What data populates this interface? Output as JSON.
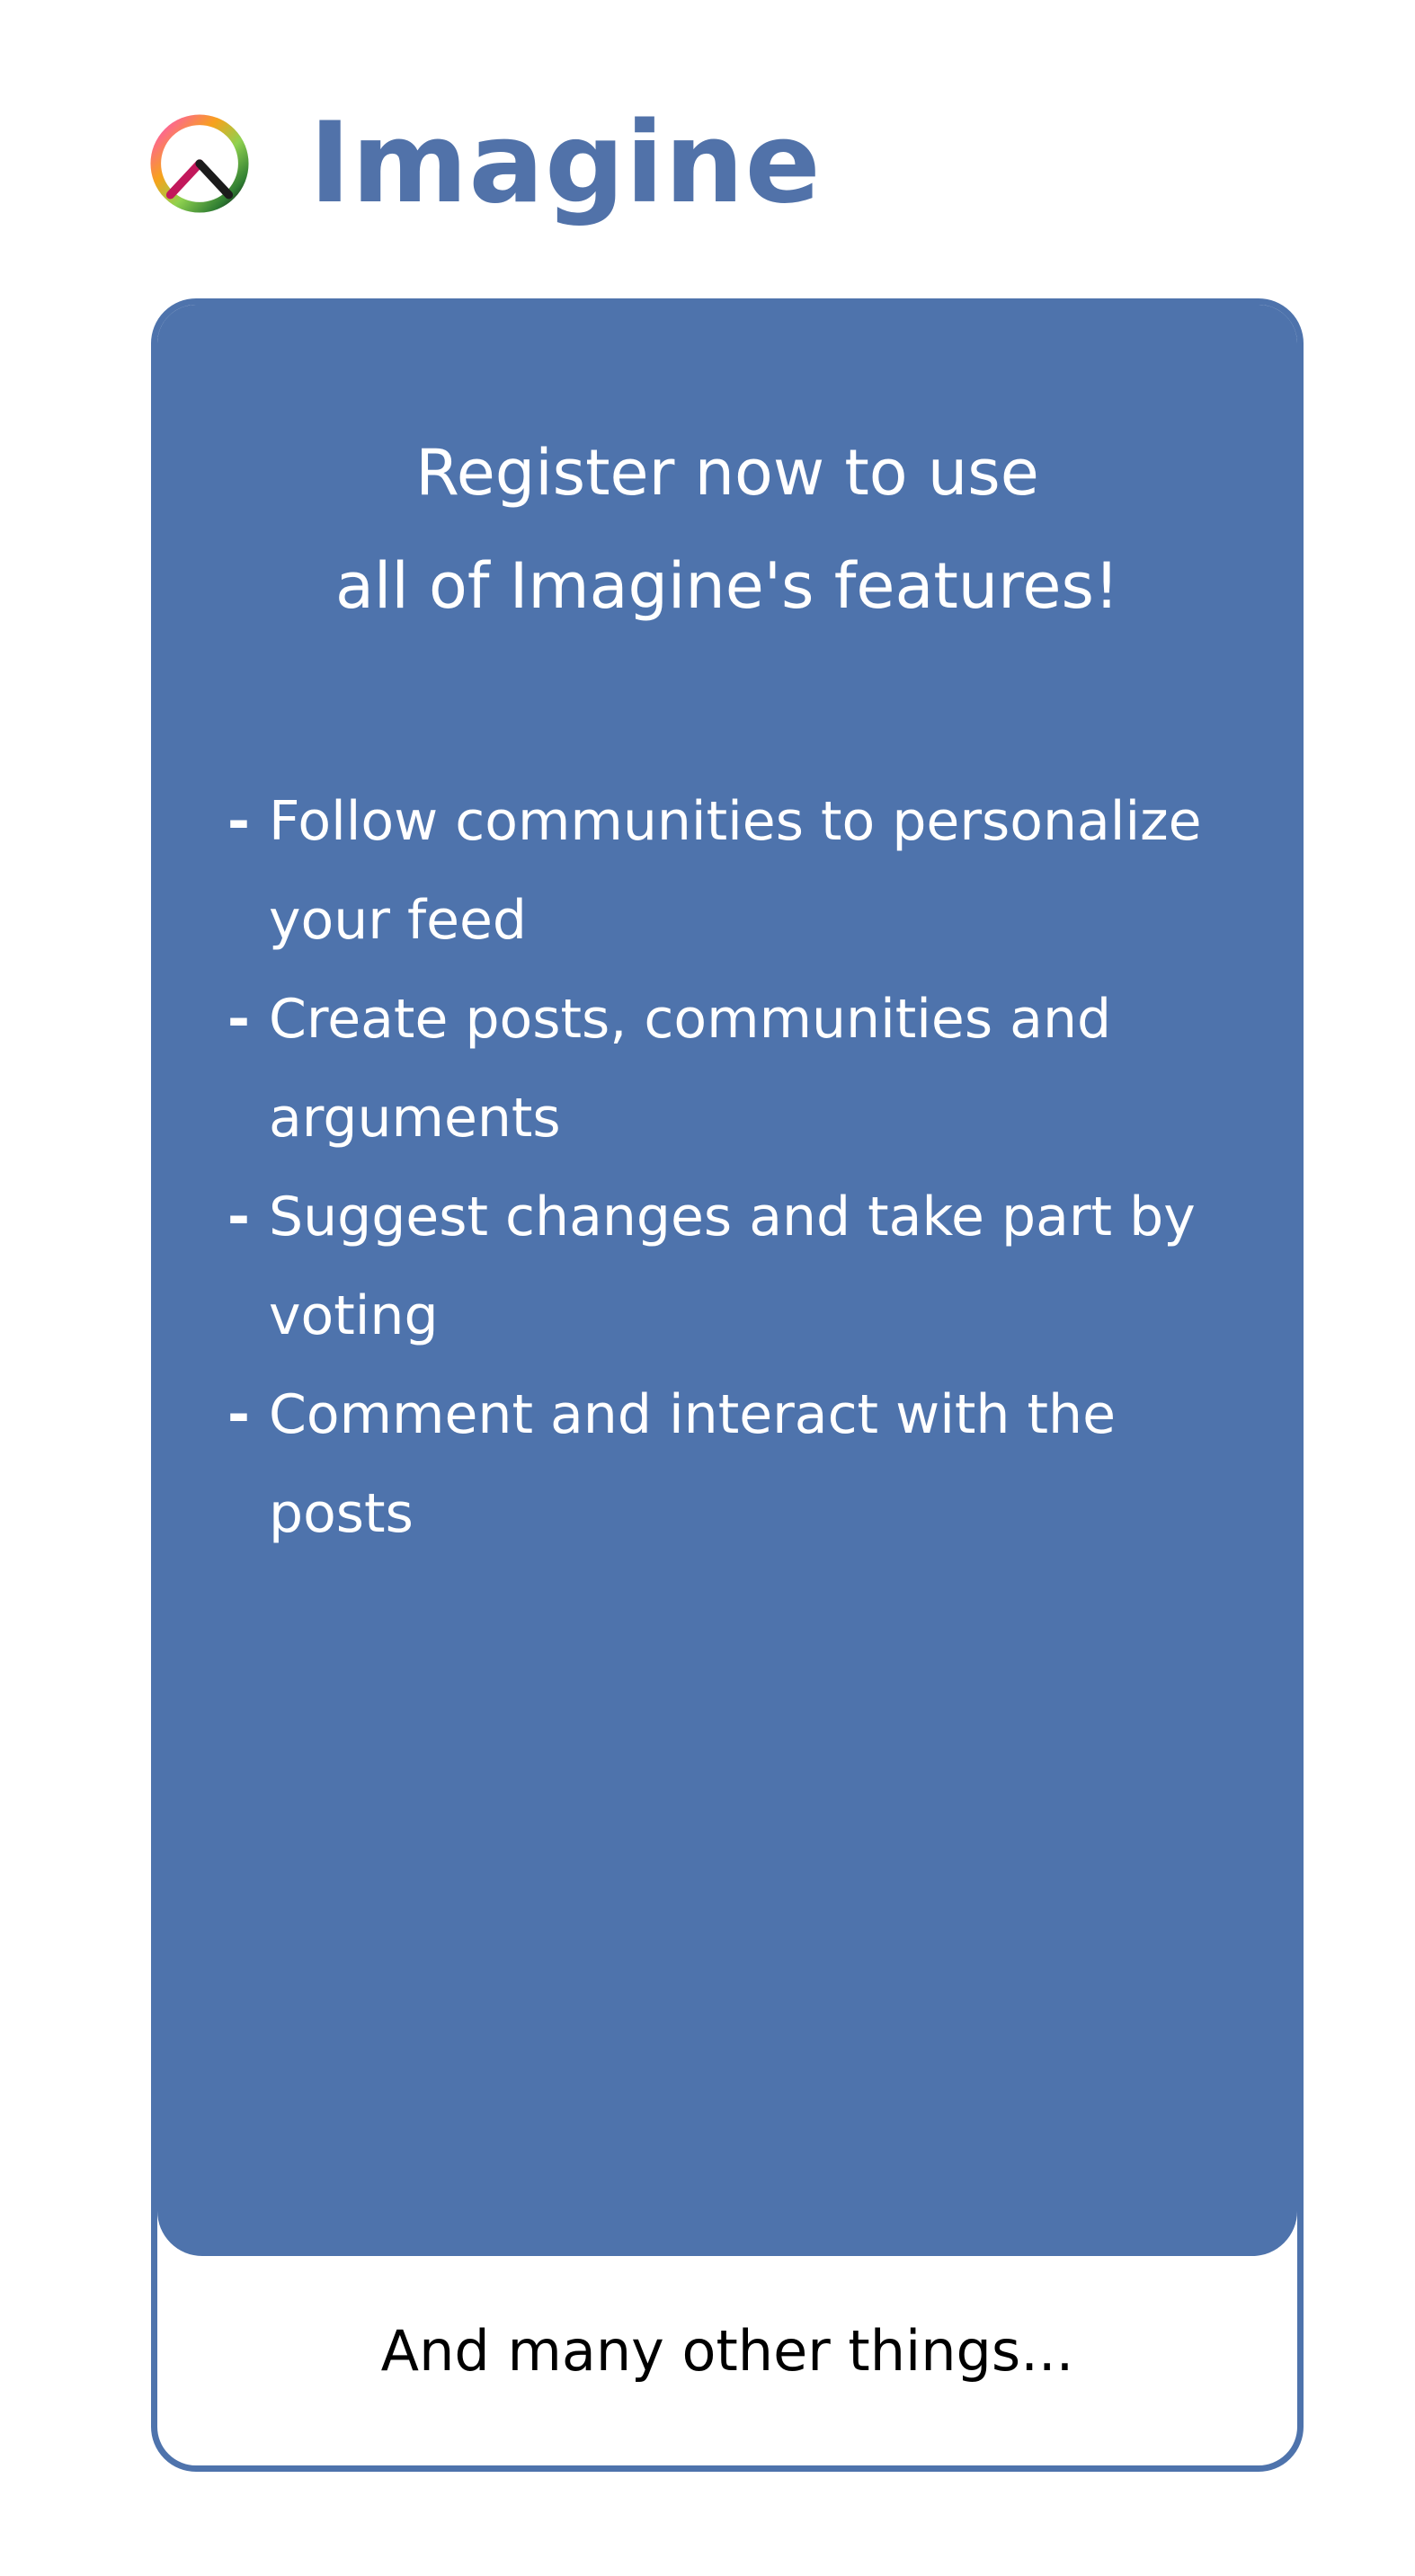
{
  "brand": {
    "app_name": "Imagine",
    "logo_icon": "peace-sign-icon",
    "logo_colors": [
      "#f7a21b",
      "#8fd14f",
      "#2f7d32",
      "#111111",
      "#c2185b",
      "#ff4fbf"
    ]
  },
  "colors": {
    "accent": "#4e73ac",
    "title_text": "#5172a9",
    "card_text": "#ffffff",
    "footer_text": "#000000"
  },
  "card": {
    "headline": {
      "line1": "Register now to use",
      "line2": "all of Imagine's features!"
    },
    "features": [
      {
        "bullet": "-",
        "text": "Follow communities to personalize your feed"
      },
      {
        "bullet": "-",
        "text": "Create posts, communities and arguments"
      },
      {
        "bullet": "-",
        "text": "Suggest changes and take part by voting"
      },
      {
        "bullet": "-",
        "text": "Comment and interact with the posts"
      }
    ],
    "footer": "And many other things..."
  }
}
